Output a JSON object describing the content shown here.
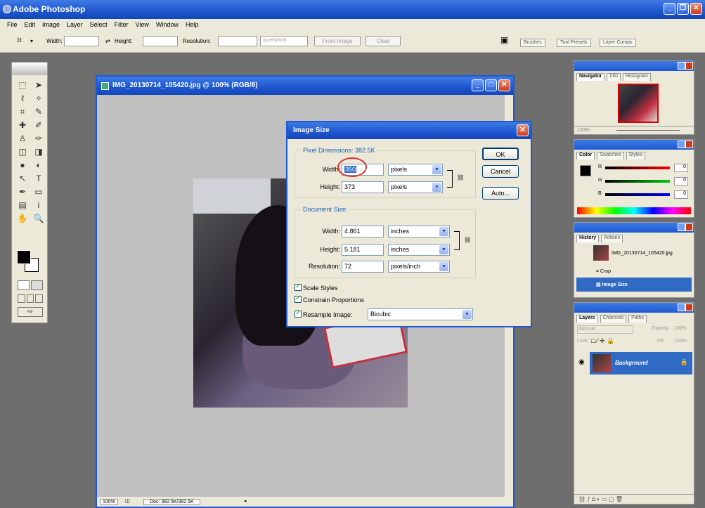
{
  "app": {
    "title": "Adobe Photoshop"
  },
  "menu": [
    "File",
    "Edit",
    "Image",
    "Layer",
    "Select",
    "Filter",
    "View",
    "Window",
    "Help"
  ],
  "options": {
    "width_label": "Width:",
    "height_label": "Height:",
    "resolution_label": "Resolution:",
    "units": "pixels/inch",
    "front_image": "Front Image",
    "clear": "Clear",
    "tabs": [
      "Brushes",
      "Tool Presets",
      "Layer Comps"
    ]
  },
  "document": {
    "title": "IMG_20130714_105420.jpg @ 100% (RGB/8)",
    "zoom": "100%",
    "doc_info": "Doc: 382.5K/382.5K"
  },
  "dialog": {
    "title": "Image Size",
    "pixel_dim_label": "Pixel Dimensions:",
    "pixel_dim_value": "382.5K",
    "width_label": "Width:",
    "width_value": "350",
    "width_unit": "pixels",
    "height_label": "Height:",
    "height_value": "373",
    "height_unit": "pixels",
    "doc_size_label": "Document Size:",
    "doc_width_label": "Width:",
    "doc_width_value": "4.861",
    "doc_width_unit": "inches",
    "doc_height_label": "Height:",
    "doc_height_value": "5.181",
    "doc_height_unit": "inches",
    "resolution_label": "Resolution:",
    "resolution_value": "72",
    "resolution_unit": "pixels/inch",
    "scale_styles": "Scale Styles",
    "constrain": "Constrain Proportions",
    "resample": "Resample Image:",
    "resample_value": "Bicubic",
    "ok": "OK",
    "cancel": "Cancel",
    "auto": "Auto..."
  },
  "navigator": {
    "tabs": [
      "Navigator",
      "Info",
      "Histogram"
    ],
    "zoom": "100%"
  },
  "color": {
    "tabs": [
      "Color",
      "Swatches",
      "Styles"
    ],
    "r": "R",
    "g": "G",
    "b": "B",
    "r_val": "0",
    "g_val": "0",
    "b_val": "0"
  },
  "history": {
    "tabs": [
      "History",
      "Actions"
    ],
    "items": [
      "IMG_20130714_105420.jpg",
      "Crop",
      "Image Size"
    ]
  },
  "layers": {
    "tabs": [
      "Layers",
      "Channels",
      "Paths"
    ],
    "blend": "Normal",
    "opacity_label": "Opacity:",
    "opacity": "100%",
    "lock_label": "Lock:",
    "fill_label": "Fill:",
    "fill": "100%",
    "layer_name": "Background"
  },
  "toolbox_icons": [
    "marquee-icon",
    "move-icon",
    "lasso-icon",
    "magic-wand-icon",
    "crop-icon",
    "slice-icon",
    "healing-icon",
    "brush-icon",
    "stamp-icon",
    "history-brush-icon",
    "eraser-icon",
    "gradient-icon",
    "blur-icon",
    "dodge-icon",
    "path-select-icon",
    "type-icon",
    "pen-icon",
    "shape-icon",
    "notes-icon",
    "eyedropper-icon",
    "hand-icon",
    "zoom-icon"
  ]
}
